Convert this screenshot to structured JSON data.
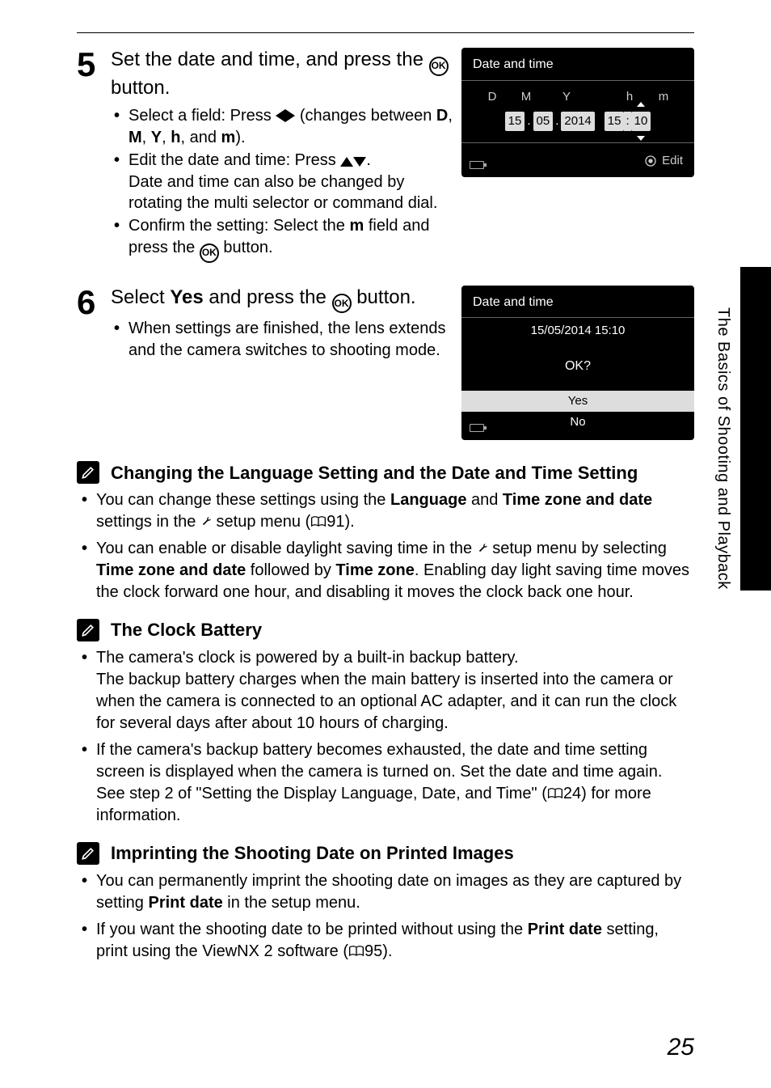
{
  "step5": {
    "num": "5",
    "head_a": "Set the date and time, and press the ",
    "head_b": " button.",
    "b1a": "Select a field: Press ",
    "b1b": " (changes between ",
    "b1c": ", and ",
    "b1d": ").",
    "f_D": "D",
    "f_M": "M",
    "f_Y": "Y",
    "f_h": "h",
    "f_m": "m",
    "b2a": "Edit the date and time: Press ",
    "b2b": ".",
    "b2c": "Date and time can also be changed by rotating the multi selector or command dial.",
    "b3a": "Confirm the setting: Select the ",
    "b3b": " field and press the ",
    "b3c": " button."
  },
  "step6": {
    "num": "6",
    "head_a": "Select ",
    "head_yes": "Yes",
    "head_b": " and press the ",
    "head_c": " button.",
    "b1": "When settings are finished, the lens extends and the camera switches to shooting mode."
  },
  "lcd1": {
    "title": "Date and time",
    "D": "D",
    "M": "M",
    "Y": "Y",
    "h": "h",
    "m": "m",
    "d_val": "15",
    "mo_val": "05",
    "y_val": "2014",
    "hr_val": "15",
    "mi_val": "10",
    "edit": "Edit"
  },
  "lcd2": {
    "title": "Date and time",
    "datestr": "15/05/2014  15:10",
    "ok": "OK?",
    "yes": "Yes",
    "no": "No"
  },
  "note1": {
    "title": "Changing the Language Setting and the Date and Time Setting",
    "b1a": "You can change these settings using the ",
    "b1_lang": "Language",
    "b1b": " and ",
    "b1_tz": "Time zone and date",
    "b1c": " settings in the ",
    "b1d": " setup menu (",
    "b1e": "91).",
    "b2a": "You can enable or disable daylight saving time in the ",
    "b2b": " setup menu by selecting ",
    "b2_tz": "Time zone and date",
    "b2c": " followed by ",
    "b2_tzo": "Time zone",
    "b2d": ". Enabling day light saving time moves the clock forward one hour, and disabling it moves the clock back one hour."
  },
  "note2": {
    "title": "The Clock Battery",
    "b1a": "The camera's clock is powered by a built-in backup battery.",
    "b1b": "The backup battery charges when the main battery is inserted into the camera or when the camera is connected to an optional AC adapter, and it can run the clock for several days after about 10 hours of charging.",
    "b2a": "If the camera's backup battery becomes exhausted, the date and time setting screen is displayed when the camera is turned on. Set the date and time again. See step 2 of \"Setting the Display Language, Date, and Time\" (",
    "b2b": "24) for more information."
  },
  "note3": {
    "title": "Imprinting the Shooting Date on Printed Images",
    "b1a": "You can permanently imprint the shooting date on images as they are captured by setting ",
    "b1_pd": "Print date",
    "b1b": " in the setup menu.",
    "b2a": "If you want the shooting date to be printed without using the ",
    "b2_pd": "Print date",
    "b2b": " setting, print using the ViewNX 2 software (",
    "b2c": "95)."
  },
  "side": {
    "label": "The Basics of Shooting and Playback"
  },
  "page_number": "25"
}
